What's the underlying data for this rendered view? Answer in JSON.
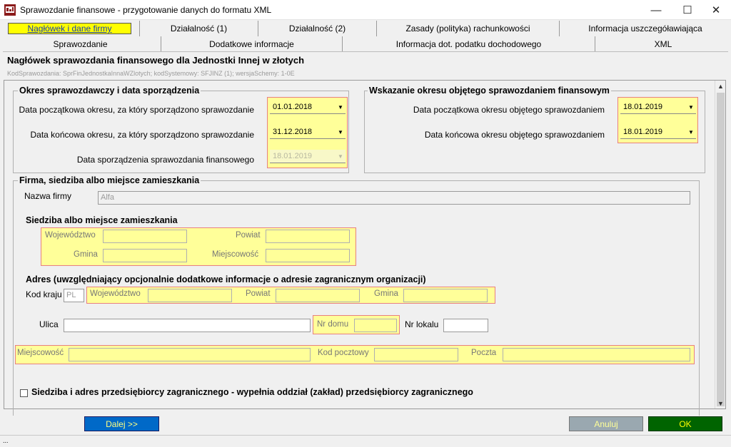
{
  "window": {
    "title": "Sprawozdanie finansowe - przygotowanie danych do formatu XML",
    "minimize_glyph": "—",
    "maximize_glyph": "☐",
    "close_glyph": "✕"
  },
  "tabs": {
    "row1": [
      "Nagłówek i dane firmy",
      "Działalność (1)",
      "Działalność (2)",
      "Zasady (polityka) rachunkowości",
      "Informacja uszczegóławiająca"
    ],
    "row2": [
      "Sprawozdanie",
      "Dodatkowe informacje",
      "Informacja dot. podatku dochodowego",
      "XML"
    ],
    "active": "Nagłówek i dane firmy"
  },
  "header": {
    "title": "Nagłówek sprawozdania finansowego dla Jednostki Innej w złotych",
    "meta": "KodSprawozdania: SprFinJednostkaInnaWZlotych; kodSystemowy: SFJINZ (1); wersjaSchemy: 1-0E"
  },
  "period": {
    "title": "Okres sprawozdawczy i data sporządzenia",
    "start_label": "Data początkowa okresu, za który sporządzono sprawozdanie",
    "start_value": "01.01.2018",
    "end_label": "Data końcowa okresu, za który sporządzono sprawozdanie",
    "end_value": "31.12.2018",
    "prepared_label": "Data sporządzenia sprawozdania finansowego",
    "prepared_value": "18.01.2019"
  },
  "covered": {
    "title": "Wskazanie okresu objętego sprawozdaniem finansowym",
    "start_label": "Data początkowa okresu objętego sprawozdaniem",
    "start_value": "18.01.2019",
    "end_label": "Data końcowa okresu objętego sprawozdaniem",
    "end_value": "18.01.2019"
  },
  "firm": {
    "title": "Firma, siedziba albo miejsce zamieszkania",
    "name_label": "Nazwa firmy",
    "name_value": "Alfa",
    "seat": {
      "title": "Siedziba albo miejsce zamieszkania",
      "voivodeship": "Województwo",
      "district": "Powiat",
      "commune": "Gmina",
      "locality": "Miejscowość"
    },
    "address": {
      "title": "Adres (uwzględniający opcjonalnie dodatkowe informacje o adresie zagranicznym organizacji)",
      "country_label": "Kod kraju",
      "country_value": "PL",
      "voivodeship": "Województwo",
      "district": "Powiat",
      "commune": "Gmina",
      "street": "Ulica",
      "house_no": "Nr domu",
      "flat_no": "Nr lokalu",
      "locality": "Miejscowość",
      "postal_code": "Kod pocztowy",
      "post_office": "Poczta"
    },
    "foreign_checkbox": "Siedziba i adres przedsiębiorcy zagranicznego - wypełnia oddział (zakład) przedsiębiorcy zagranicznego"
  },
  "buttons": {
    "next": "Dalej >>",
    "cancel": "Anuluj",
    "ok": "OK"
  },
  "status": {
    "grip": "..."
  },
  "colors": {
    "highlight": "#ffff99",
    "highlight_border": "#e88080",
    "next_button": "#0069c8",
    "ok_button": "#006400"
  }
}
